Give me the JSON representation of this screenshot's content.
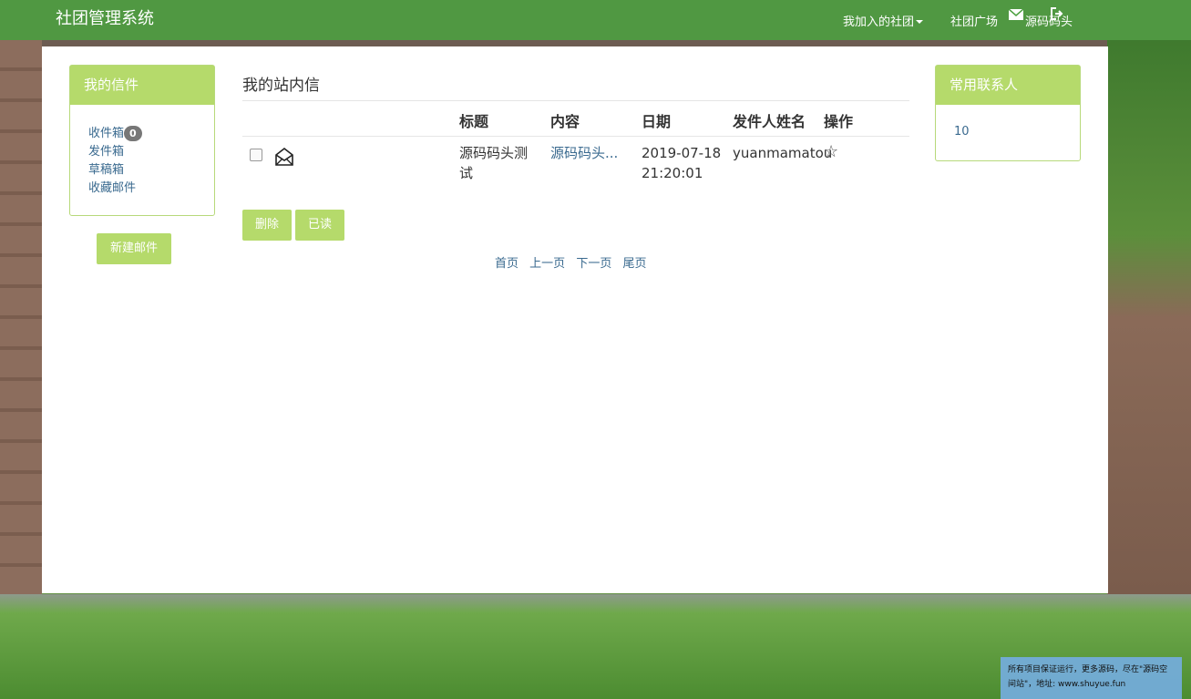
{
  "navbar": {
    "brand": "社团管理系统",
    "items": [
      {
        "label": "我加入的社团"
      },
      {
        "label": "社团广场"
      },
      {
        "label": "源码码头"
      }
    ],
    "icons": [
      "mail-icon",
      "logout-icon"
    ]
  },
  "left": {
    "title": "我的信件",
    "folders": [
      {
        "label": "收件箱",
        "badge": "0"
      },
      {
        "label": "发件箱"
      },
      {
        "label": "草稿箱"
      },
      {
        "label": "收藏邮件"
      }
    ],
    "new_mail_label": "新建邮件"
  },
  "main": {
    "title": "我的站内信",
    "columns": [
      "标题",
      "内容",
      "日期",
      "发件人姓名",
      "操作"
    ],
    "rows": [
      {
        "title": "源码码头测试",
        "content": "源码码头...",
        "date": "2019-07-18 21:20:01",
        "sender": "yuanmamatou",
        "action": "☆"
      }
    ],
    "delete_label": "删除",
    "read_label": "已读",
    "pager": [
      "首页",
      "上一页",
      "下一页",
      "尾页"
    ]
  },
  "right": {
    "title": "常用联系人",
    "contacts": [
      "10"
    ]
  },
  "footer_note": "所有项目保证运行，更多源码，尽在\"源码空间站\"，地址: www.shuyue.fun",
  "colors": {
    "navbar": "#4ca040",
    "accent": "#b5da6b",
    "link": "#3a6a8f"
  }
}
